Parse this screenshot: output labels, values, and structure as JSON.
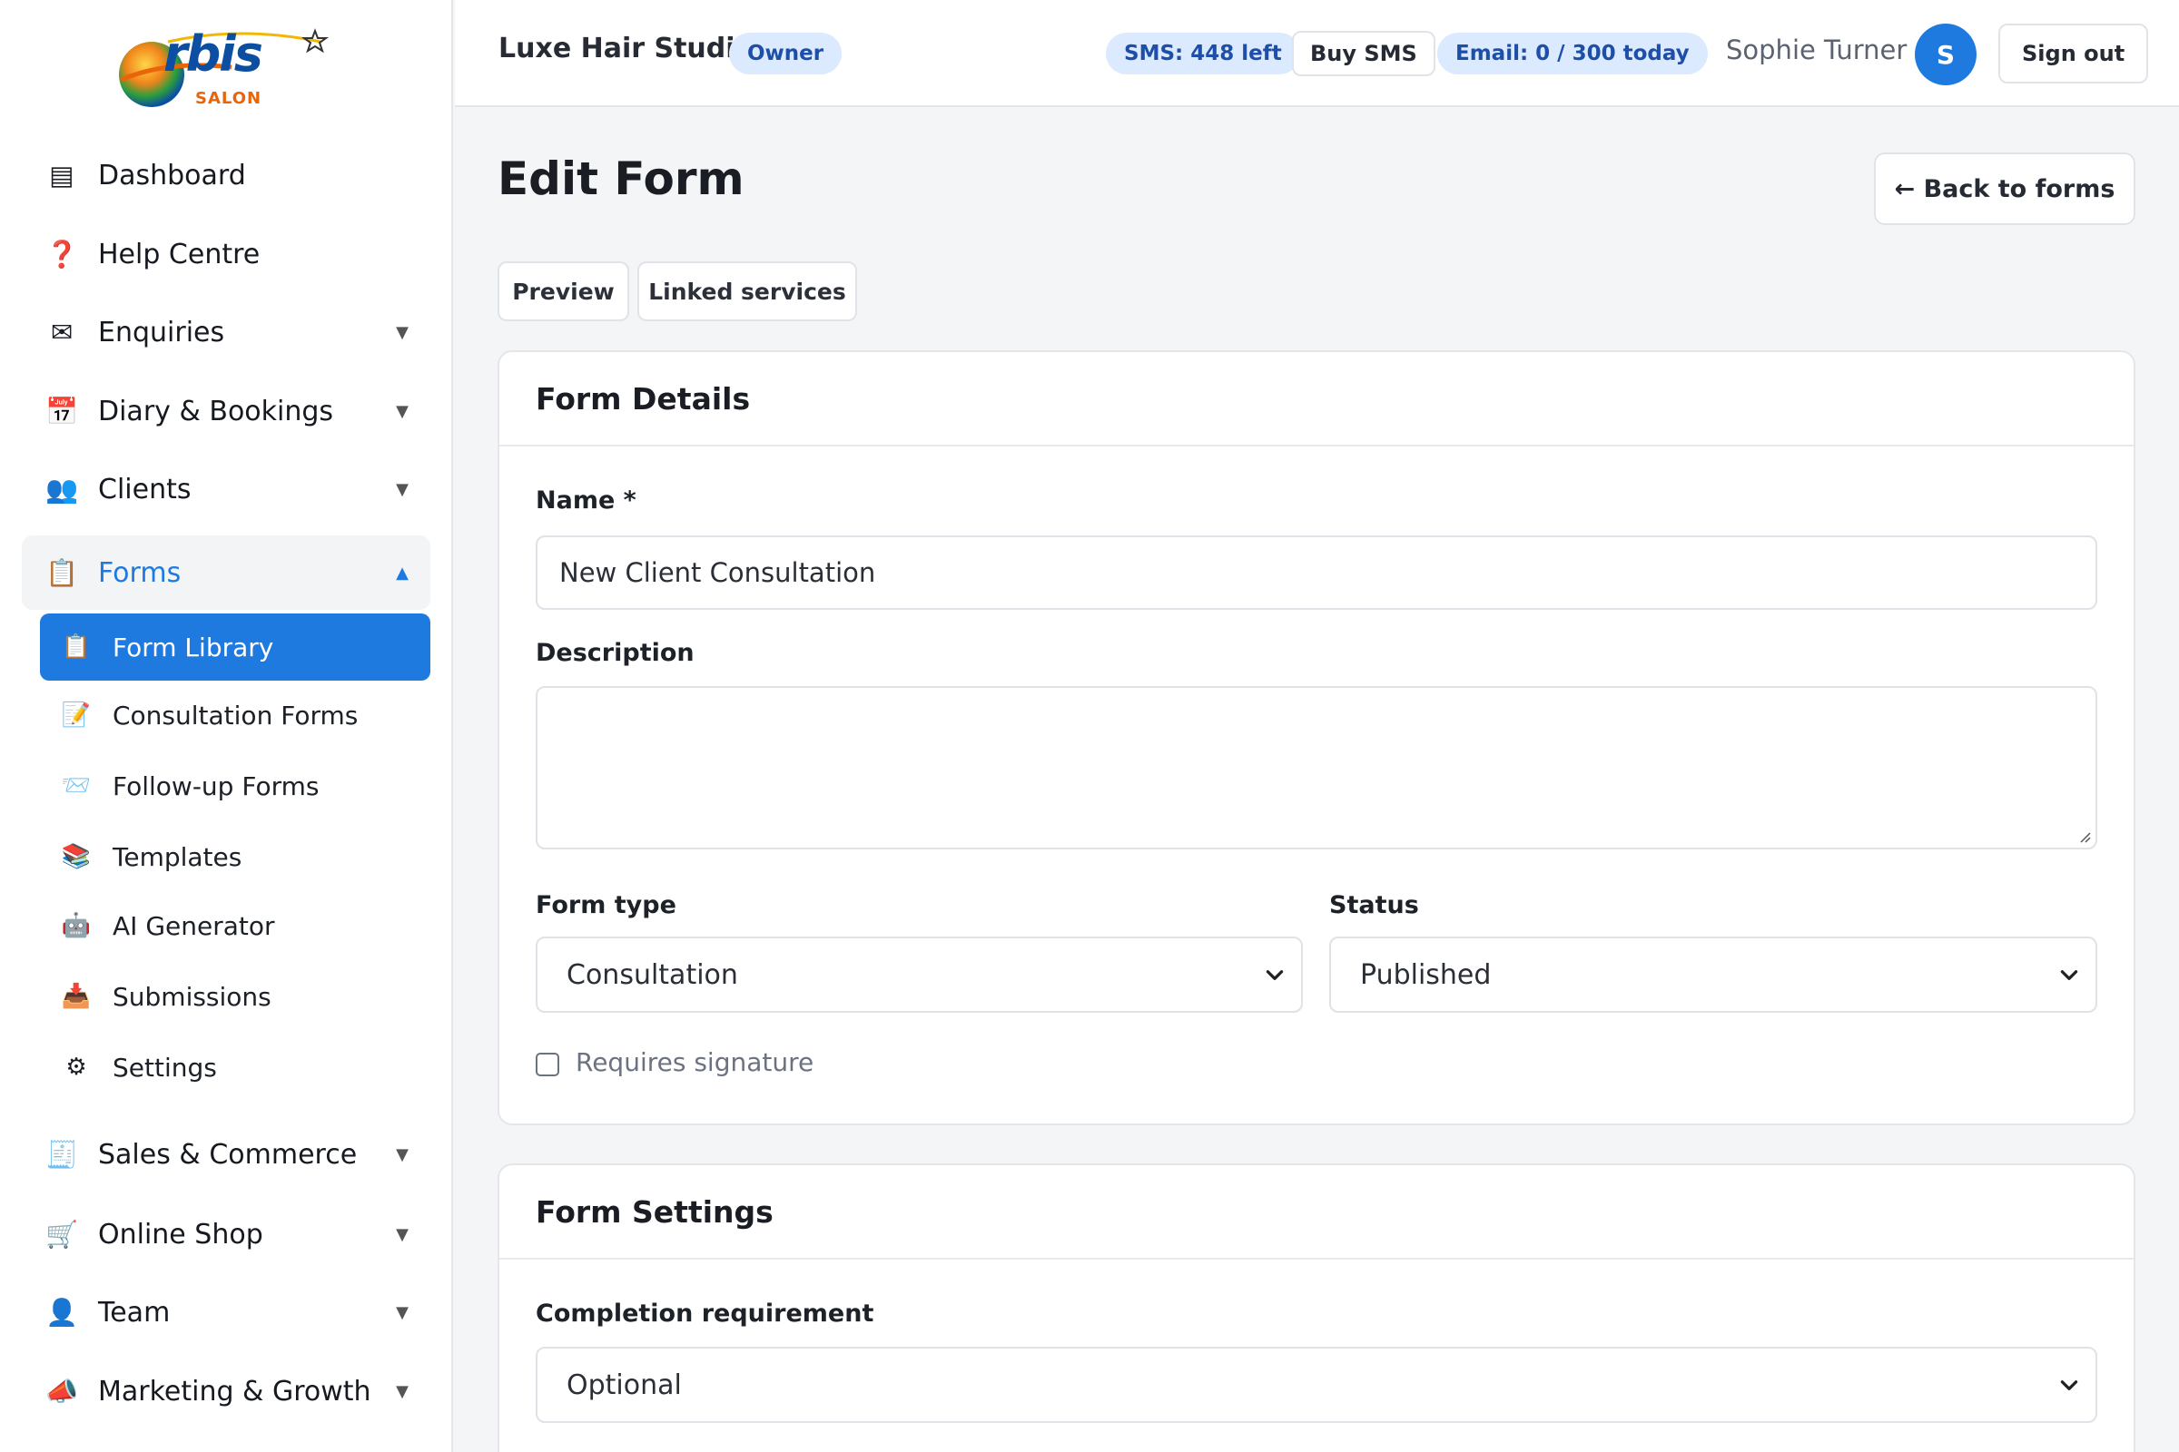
{
  "brand": {
    "logo_text": "rbis",
    "logo_sub": "SALON"
  },
  "sidebar": {
    "items": [
      {
        "icon": "▤",
        "label": "Dashboard",
        "caret": ""
      },
      {
        "icon": "❓",
        "label": "Help Centre",
        "caret": ""
      },
      {
        "icon": "✉",
        "label": "Enquiries",
        "caret": "▼"
      },
      {
        "icon": "📅",
        "label": "Diary & Bookings",
        "caret": "▼"
      },
      {
        "icon": "👥",
        "label": "Clients",
        "caret": "▼"
      },
      {
        "icon": "📋",
        "label": "Forms",
        "caret": "▲"
      },
      {
        "icon": "🧾",
        "label": "Sales & Commerce",
        "caret": "▼"
      },
      {
        "icon": "🛒",
        "label": "Online Shop",
        "caret": "▼"
      },
      {
        "icon": "👤",
        "label": "Team",
        "caret": "▼"
      },
      {
        "icon": "📣",
        "label": "Marketing & Growth",
        "caret": "▼"
      }
    ],
    "forms_sub": [
      {
        "icon": "📋",
        "label": "Form Library"
      },
      {
        "icon": "📝",
        "label": "Consultation Forms"
      },
      {
        "icon": "📨",
        "label": "Follow-up Forms"
      },
      {
        "icon": "📚",
        "label": "Templates"
      },
      {
        "icon": "🤖",
        "label": "AI Generator"
      },
      {
        "icon": "📥",
        "label": "Submissions"
      },
      {
        "icon": "⚙",
        "label": "Settings"
      }
    ]
  },
  "topbar": {
    "studio": "Luxe Hair Studio",
    "role_badge": "Owner",
    "sms_badge": "SMS: 448 left",
    "buy_sms": "Buy SMS",
    "email_badge": "Email: 0 / 300 today",
    "user_name": "Sophie Turner",
    "avatar_initial": "S",
    "sign_out": "Sign out"
  },
  "page": {
    "title": "Edit Form",
    "back": "← Back to forms",
    "tabs": [
      "Preview",
      "Linked services"
    ]
  },
  "form_details": {
    "heading": "Form Details",
    "name_label": "Name *",
    "name_value": "New Client Consultation",
    "description_label": "Description",
    "description_value": "",
    "type_label": "Form type",
    "type_value": "Consultation",
    "status_label": "Status",
    "status_value": "Published",
    "signature_label": "Requires signature",
    "signature_checked": false
  },
  "form_settings": {
    "heading": "Form Settings",
    "completion_label": "Completion requirement",
    "completion_value": "Optional"
  },
  "colors": {
    "accent": "#1f7ae0",
    "badge_bg": "#dbeafe",
    "badge_text": "#1d4ea8"
  }
}
